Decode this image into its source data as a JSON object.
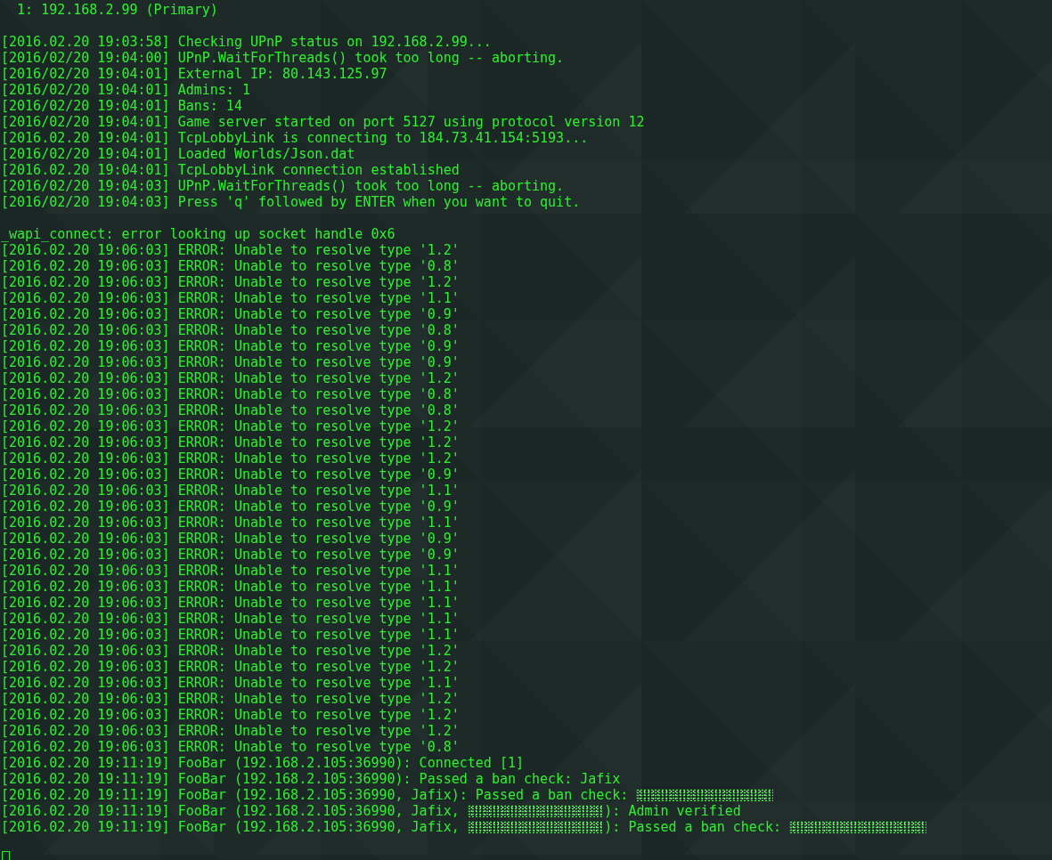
{
  "terminal": {
    "blocks": [
      {
        "lines": [
          {
            "text": "  1: 192.168.2.99 (Primary)"
          }
        ]
      },
      {
        "lines": [
          {
            "text": "[2016.02.20 19:03:58] Checking UPnP status on 192.168.2.99..."
          },
          {
            "text": "[2016/02/20 19:04:00] UPnP.WaitForThreads() took too long -- aborting."
          },
          {
            "text": "[2016/02/20 19:04:01] External IP: 80.143.125.97"
          },
          {
            "text": "[2016/02/20 19:04:01] Admins: 1"
          },
          {
            "text": "[2016/02/20 19:04:01] Bans: 14"
          },
          {
            "text": "[2016/02/20 19:04:01] Game server started on port 5127 using protocol version 12"
          },
          {
            "text": "[2016.02.20 19:04:01] TcpLobbyLink is connecting to 184.73.41.154:5193..."
          },
          {
            "text": "[2016/02/20 19:04:01] Loaded Worlds/Json.dat"
          },
          {
            "text": "[2016.02.20 19:04:01] TcpLobbyLink connection established"
          },
          {
            "text": "[2016/02/20 19:04:03] UPnP.WaitForThreads() took too long -- aborting."
          },
          {
            "text": "[2016/02/20 19:04:03] Press 'q' followed by ENTER when you want to quit."
          }
        ]
      },
      {
        "lines": [
          {
            "text": "_wapi_connect: error looking up socket handle 0x6"
          },
          {
            "text": "[2016.02.20 19:06:03] ERROR: Unable to resolve type '1.2'"
          },
          {
            "text": "[2016.02.20 19:06:03] ERROR: Unable to resolve type '0.8'"
          },
          {
            "text": "[2016.02.20 19:06:03] ERROR: Unable to resolve type '1.2'"
          },
          {
            "text": "[2016.02.20 19:06:03] ERROR: Unable to resolve type '1.1'"
          },
          {
            "text": "[2016.02.20 19:06:03] ERROR: Unable to resolve type '0.9'"
          },
          {
            "text": "[2016.02.20 19:06:03] ERROR: Unable to resolve type '0.8'"
          },
          {
            "text": "[2016.02.20 19:06:03] ERROR: Unable to resolve type '0.9'"
          },
          {
            "text": "[2016.02.20 19:06:03] ERROR: Unable to resolve type '0.9'"
          },
          {
            "text": "[2016.02.20 19:06:03] ERROR: Unable to resolve type '1.2'"
          },
          {
            "text": "[2016.02.20 19:06:03] ERROR: Unable to resolve type '0.8'"
          },
          {
            "text": "[2016.02.20 19:06:03] ERROR: Unable to resolve type '0.8'"
          },
          {
            "text": "[2016.02.20 19:06:03] ERROR: Unable to resolve type '1.2'"
          },
          {
            "text": "[2016.02.20 19:06:03] ERROR: Unable to resolve type '1.2'"
          },
          {
            "text": "[2016.02.20 19:06:03] ERROR: Unable to resolve type '1.2'"
          },
          {
            "text": "[2016.02.20 19:06:03] ERROR: Unable to resolve type '0.9'"
          },
          {
            "text": "[2016.02.20 19:06:03] ERROR: Unable to resolve type '1.1'"
          },
          {
            "text": "[2016.02.20 19:06:03] ERROR: Unable to resolve type '0.9'"
          },
          {
            "text": "[2016.02.20 19:06:03] ERROR: Unable to resolve type '1.1'"
          },
          {
            "text": "[2016.02.20 19:06:03] ERROR: Unable to resolve type '0.9'"
          },
          {
            "text": "[2016.02.20 19:06:03] ERROR: Unable to resolve type '0.9'"
          },
          {
            "text": "[2016.02.20 19:06:03] ERROR: Unable to resolve type '1.1'"
          },
          {
            "text": "[2016.02.20 19:06:03] ERROR: Unable to resolve type '1.1'"
          },
          {
            "text": "[2016.02.20 19:06:03] ERROR: Unable to resolve type '1.1'"
          },
          {
            "text": "[2016.02.20 19:06:03] ERROR: Unable to resolve type '1.1'"
          },
          {
            "text": "[2016.02.20 19:06:03] ERROR: Unable to resolve type '1.1'"
          },
          {
            "text": "[2016.02.20 19:06:03] ERROR: Unable to resolve type '1.2'"
          },
          {
            "text": "[2016.02.20 19:06:03] ERROR: Unable to resolve type '1.2'"
          },
          {
            "text": "[2016.02.20 19:06:03] ERROR: Unable to resolve type '1.1'"
          },
          {
            "text": "[2016.02.20 19:06:03] ERROR: Unable to resolve type '1.2'"
          },
          {
            "text": "[2016.02.20 19:06:03] ERROR: Unable to resolve type '1.2'"
          },
          {
            "text": "[2016.02.20 19:06:03] ERROR: Unable to resolve type '1.2'"
          },
          {
            "text": "[2016.02.20 19:06:03] ERROR: Unable to resolve type '0.8'"
          },
          {
            "text": "[2016.02.20 19:11:19] FooBar (192.168.2.105:36990): Connected [1]"
          },
          {
            "text": "[2016.02.20 19:11:19] FooBar (192.168.2.105:36990): Passed a ban check: Jafix"
          },
          {
            "parts": [
              {
                "kind": "text",
                "text": "[2016.02.20 19:11:19] FooBar (192.168.2.105:36990, Jafix): Passed a ban check: "
              },
              {
                "kind": "redacted"
              }
            ]
          },
          {
            "parts": [
              {
                "kind": "text",
                "text": "[2016.02.20 19:11:19] FooBar (192.168.2.105:36990, Jafix, "
              },
              {
                "kind": "redacted"
              },
              {
                "kind": "text",
                "text": "): Admin verified"
              }
            ]
          },
          {
            "parts": [
              {
                "kind": "text",
                "text": "[2016.02.20 19:11:19] FooBar (192.168.2.105:36990, Jafix, "
              },
              {
                "kind": "redacted"
              },
              {
                "kind": "text",
                "text": "): Passed a ban check: "
              },
              {
                "kind": "redacted"
              }
            ]
          }
        ]
      }
    ]
  }
}
